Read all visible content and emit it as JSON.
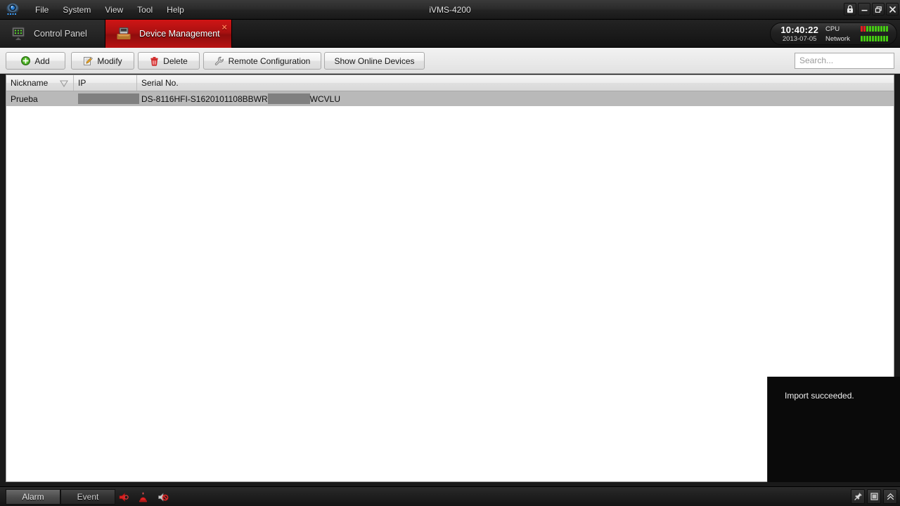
{
  "window": {
    "title": "iVMS-4200",
    "controls": [
      {
        "name": "lock-icon",
        "label": "Lock"
      },
      {
        "name": "minimize-icon",
        "label": "Minimize"
      },
      {
        "name": "restore-icon",
        "label": "Restore"
      },
      {
        "name": "close-icon",
        "label": "Close"
      }
    ]
  },
  "menubar": {
    "items": [
      {
        "label": "File"
      },
      {
        "label": "System"
      },
      {
        "label": "View"
      },
      {
        "label": "Tool"
      },
      {
        "label": "Help"
      }
    ]
  },
  "tabs": [
    {
      "label": "Control Panel",
      "icon": "control-panel-icon",
      "active": false,
      "closable": false
    },
    {
      "label": "Device Management",
      "icon": "device-management-icon",
      "active": true,
      "closable": true,
      "close_label": "×"
    }
  ],
  "status": {
    "time": "10:40:22",
    "date": "2013-07-05",
    "cpu": {
      "label": "CPU",
      "segments": [
        "r",
        "r",
        "g",
        "g",
        "g",
        "g",
        "g",
        "g",
        "g",
        "g"
      ]
    },
    "network": {
      "label": "Network",
      "segments": [
        "g",
        "g",
        "g",
        "g",
        "g",
        "g",
        "g",
        "g",
        "g",
        "g"
      ]
    }
  },
  "toolbar": {
    "buttons": [
      {
        "label": "Add",
        "icon": "add-icon"
      },
      {
        "label": "Modify",
        "icon": "modify-icon"
      },
      {
        "label": "Delete",
        "icon": "delete-icon"
      },
      {
        "label": "Remote Configuration",
        "icon": "wrench-icon"
      },
      {
        "label": "Show Online Devices",
        "icon": "none"
      }
    ],
    "search": {
      "placeholder": "Search...",
      "value": ""
    }
  },
  "table": {
    "columns": [
      {
        "label": "Nickname",
        "sort": "descending"
      },
      {
        "label": "IP",
        "sort": "none"
      },
      {
        "label": "Serial No.",
        "sort": "none"
      }
    ],
    "rows": [
      {
        "nickname": "Prueba",
        "ip": "",
        "ip_redacted": true,
        "serial_prefix": "DS-8116HFI-S1620101108BBWR",
        "serial_redacted": true,
        "serial_suffix": "WCVLU",
        "selected": true
      }
    ]
  },
  "notification": {
    "message": "Import succeeded."
  },
  "bottombar": {
    "tabs": [
      {
        "label": "Alarm",
        "active": true
      },
      {
        "label": "Event",
        "active": false
      }
    ],
    "icons": [
      {
        "name": "alarm-output-icon"
      },
      {
        "name": "alarm-siren-icon"
      },
      {
        "name": "alarm-mute-icon"
      }
    ],
    "corner_buttons": [
      {
        "name": "pin-icon"
      },
      {
        "name": "maximize-panel-icon"
      },
      {
        "name": "collapse-up-icon"
      }
    ]
  },
  "colors": {
    "accent_red": "#b81212",
    "meter_green": "#49d116",
    "meter_red": "#e02020",
    "selection_gray": "#b9b9b9",
    "redaction_gray": "#808080"
  }
}
